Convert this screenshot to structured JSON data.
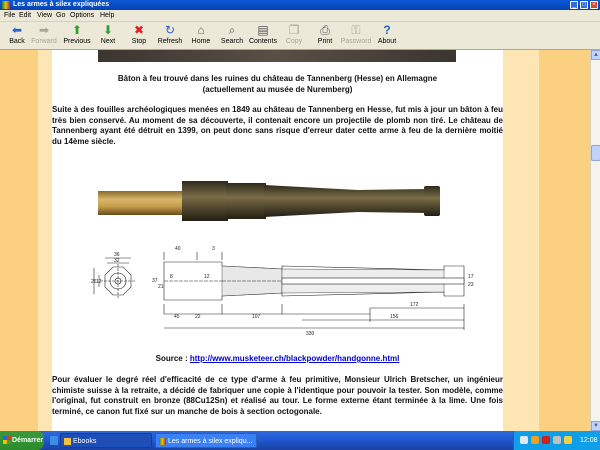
{
  "window": {
    "title": "Les armes à silex expliquées",
    "controls": {
      "minimize": "_",
      "maximize": "□",
      "close": "×"
    }
  },
  "menu": [
    "File",
    "Edit",
    "View",
    "Go",
    "Options",
    "Help"
  ],
  "toolbar": [
    {
      "label": "Back",
      "icon": "back-arrow-icon",
      "glyph": "⬅",
      "enabled": true
    },
    {
      "label": "Forward",
      "icon": "forward-arrow-icon",
      "glyph": "➡",
      "enabled": false
    },
    {
      "label": "Previous",
      "icon": "up-arrow-icon",
      "glyph": "⬆",
      "enabled": true
    },
    {
      "label": "Next",
      "icon": "down-arrow-icon",
      "glyph": "⬇",
      "enabled": true
    },
    {
      "label": "Stop",
      "icon": "stop-icon",
      "glyph": "✖",
      "enabled": true
    },
    {
      "label": "Refresh",
      "icon": "refresh-icon",
      "glyph": "↻",
      "enabled": true
    },
    {
      "label": "Home",
      "icon": "home-icon",
      "glyph": "⌂",
      "enabled": true
    },
    {
      "label": "Search",
      "icon": "search-icon",
      "glyph": "⌕",
      "enabled": true
    },
    {
      "label": "Contents",
      "icon": "contents-icon",
      "glyph": "▤",
      "enabled": true
    },
    {
      "label": "Copy",
      "icon": "copy-icon",
      "glyph": "❐",
      "enabled": false
    },
    {
      "label": "Print",
      "icon": "print-icon",
      "glyph": "⎙",
      "enabled": true
    },
    {
      "label": "Password",
      "icon": "password-icon",
      "glyph": "⚿",
      "enabled": false
    },
    {
      "label": "About",
      "icon": "about-icon",
      "glyph": "?",
      "enabled": true
    }
  ],
  "content": {
    "caption_line1": "Bâton à feu trouvé dans les ruines du château de Tannenberg (Hesse) en Allemagne",
    "caption_line2": "(actuellement au musée de Nuremberg)",
    "paragraph1": "Suite à des fouilles archéologiques menées en 1849 au château de Tannenberg en Hesse, fut mis à jour un bâton à feu très bien conservé. Au moment de sa découverte, il contenait encore un projectile de plomb non tiré. Le château de Tannenberg ayant été détruit en 1399, on peut donc sans risque d'erreur dater cette arme à feu de la dernière moitié du 14ème siècle.",
    "source_label": "Source :",
    "source_url": "http://www.musketeer.ch/blackpowder/handgonne.html",
    "paragraph2": "Pour évaluer le degré réel d'efficacité de ce type d'arme à feu primitive, Monsieur Ulrich Bretscher, un ingénieur chimiste suisse à la retraite, a décidé de fabriquer une copie à l'identique pour pouvoir la tester. Son modèle, comme l'original, fut construit en bronze (88Cu12Sn) et réalisé au tour. Le forme externe étant terminée à la lime. Une fois terminé, ce canon fut fixé sur un manche de bois à section octogonale."
  },
  "drawing_dims": {
    "top": [
      "36",
      "32",
      "40",
      "3",
      "8"
    ],
    "side": [
      "26",
      "12",
      "12",
      "37",
      "21",
      "17",
      "23"
    ],
    "bottom": [
      "45",
      "22",
      "107",
      "172",
      "156",
      "330"
    ]
  },
  "taskbar": {
    "start": "Démarrer",
    "tasks": [
      {
        "label": "Ebooks",
        "active": false
      },
      {
        "label": "Les armes à silex expliqu...",
        "active": true
      }
    ],
    "clock": "12:08"
  },
  "colors": {
    "band_dark": "#fbd080",
    "band_light": "#fde6b4",
    "link": "#0000cc",
    "titlebar": "#0a58d8"
  }
}
